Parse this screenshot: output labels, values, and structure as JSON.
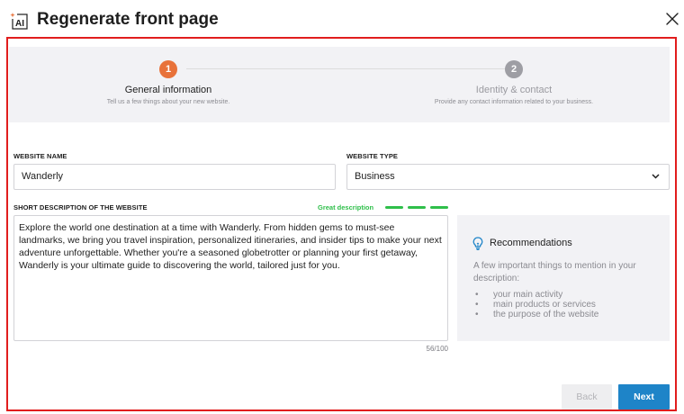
{
  "dialog": {
    "icon_text": "AI",
    "title": "Regenerate front page"
  },
  "steps": [
    {
      "number": "1",
      "title": "General information",
      "subtitle": "Tell us a few things about your new website.",
      "state": "active",
      "color": "#e8723a"
    },
    {
      "number": "2",
      "title": "Identity & contact",
      "subtitle": "Provide any contact information related to your business.",
      "state": "inactive",
      "color": "#9e9ea4"
    }
  ],
  "form": {
    "website_name_label": "WEBSITE NAME",
    "website_name_value": "Wanderly",
    "website_type_label": "WEBSITE TYPE",
    "website_type_value": "Business",
    "description_label": "SHORT DESCRIPTION OF THE WEBSITE",
    "description_quality": "Great description",
    "description_quality_color": "#2fbf4a",
    "description_value": "Explore the world one destination at a time with Wanderly. From hidden gems to must-see landmarks, we bring you travel inspiration, personalized itineraries, and insider tips to make your next adventure unforgettable. Whether you're a seasoned globetrotter or planning your first getaway, Wanderly is your ultimate guide to discovering the world, tailored just for you.",
    "description_counter": "56/100"
  },
  "recommendations": {
    "title": "Recommendations",
    "text": "A few important things to mention in your description:",
    "items": [
      "your main activity",
      "main products or services",
      "the purpose of the website"
    ]
  },
  "buttons": {
    "back": "Back",
    "next": "Next"
  },
  "colors": {
    "accent": "#1e84c8",
    "highlight_frame": "#e11d1d"
  }
}
